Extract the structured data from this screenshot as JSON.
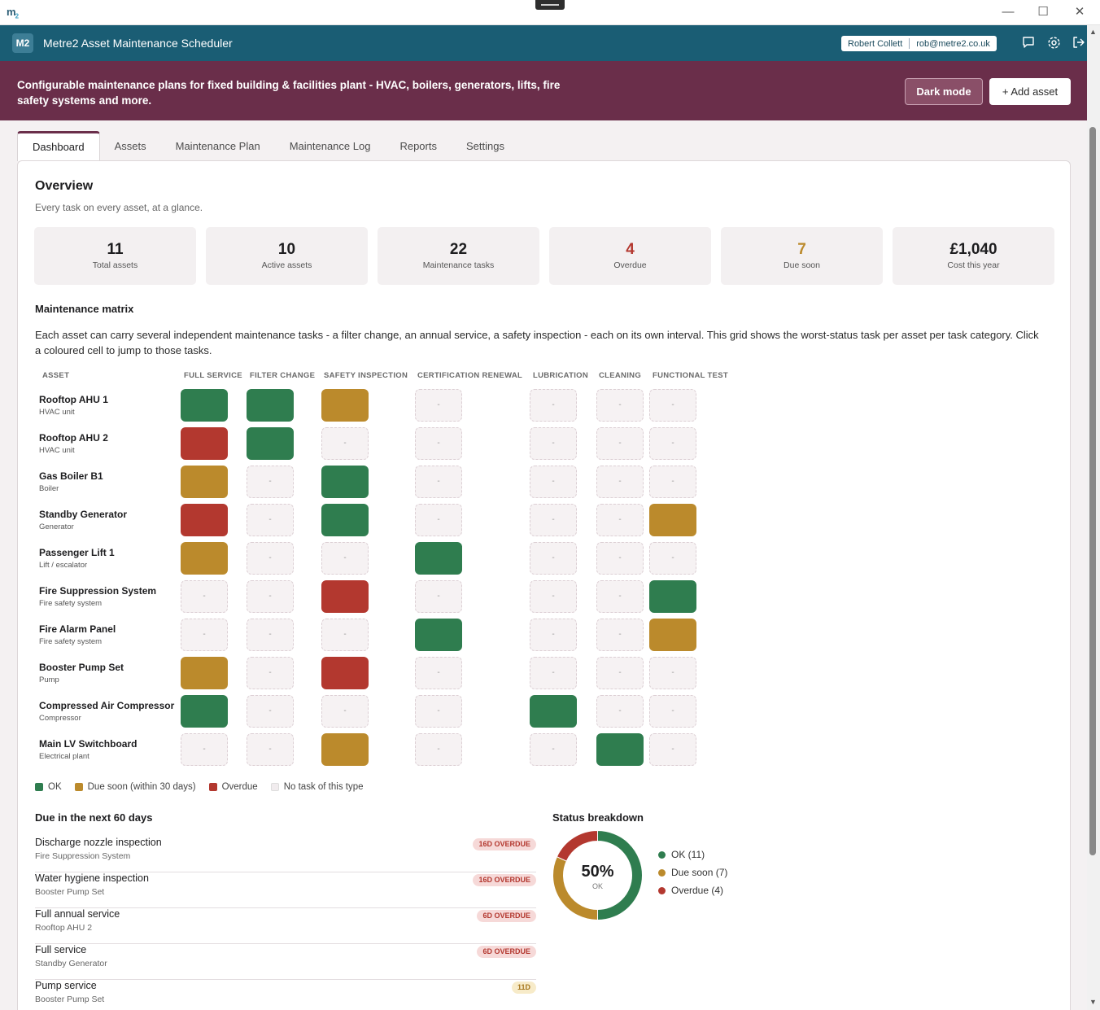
{
  "window": {
    "logo": "m",
    "logo_sub": "2",
    "minimize": "—",
    "maximize": "☐",
    "close": "✕"
  },
  "appbar": {
    "logo": "M2",
    "title": "Metre2 Asset Maintenance Scheduler",
    "user_name": "Robert Collett",
    "user_email": "rob@metre2.co.uk"
  },
  "banner": {
    "text": "Configurable maintenance plans for fixed building & facilities plant - HVAC, boilers, generators, lifts, fire safety systems and more.",
    "dark_mode_label": "Dark mode",
    "add_asset_label": "+ Add asset"
  },
  "tabs": [
    "Dashboard",
    "Assets",
    "Maintenance Plan",
    "Maintenance Log",
    "Reports",
    "Settings"
  ],
  "overview": {
    "title": "Overview",
    "subtitle": "Every task on every asset, at a glance."
  },
  "stats": [
    {
      "value": "11",
      "label": "Total assets",
      "color": "#1d1d1f"
    },
    {
      "value": "10",
      "label": "Active assets",
      "color": "#1d1d1f"
    },
    {
      "value": "22",
      "label": "Maintenance tasks",
      "color": "#1d1d1f"
    },
    {
      "value": "4",
      "label": "Overdue",
      "color": "#b3382f"
    },
    {
      "value": "7",
      "label": "Due soon",
      "color": "#bb8a2c"
    },
    {
      "value": "£1,040",
      "label": "Cost this year",
      "color": "#1d1d1f"
    }
  ],
  "matrix": {
    "title": "Maintenance matrix",
    "description": "Each asset can carry several independent maintenance tasks - a filter change, an annual service, a safety inspection - each on its own interval. This grid shows the worst-status task per asset per task category. Click a coloured cell to jump to those tasks.",
    "asset_header": "ASSET",
    "columns": [
      "FULL SERVICE",
      "FILTER CHANGE",
      "SAFETY INSPECTION",
      "CERTIFICATION RENEWAL",
      "LUBRICATION",
      "CLEANING",
      "FUNCTIONAL TEST"
    ],
    "empty_symbol": "-",
    "rows": [
      {
        "name": "Rooftop AHU 1",
        "type": "HVAC unit",
        "cells": [
          "ok",
          "ok",
          "due",
          "none",
          "none",
          "none",
          "none"
        ]
      },
      {
        "name": "Rooftop AHU 2",
        "type": "HVAC unit",
        "cells": [
          "over",
          "ok",
          "none",
          "none",
          "none",
          "none",
          "none"
        ]
      },
      {
        "name": "Gas Boiler B1",
        "type": "Boiler",
        "cells": [
          "due",
          "none",
          "ok",
          "none",
          "none",
          "none",
          "none"
        ]
      },
      {
        "name": "Standby Generator",
        "type": "Generator",
        "cells": [
          "over",
          "none",
          "ok",
          "none",
          "none",
          "none",
          "due"
        ]
      },
      {
        "name": "Passenger Lift 1",
        "type": "Lift / escalator",
        "cells": [
          "due",
          "none",
          "none",
          "ok",
          "none",
          "none",
          "none"
        ]
      },
      {
        "name": "Fire Suppression System",
        "type": "Fire safety system",
        "cells": [
          "none",
          "none",
          "over",
          "none",
          "none",
          "none",
          "ok"
        ]
      },
      {
        "name": "Fire Alarm Panel",
        "type": "Fire safety system",
        "cells": [
          "none",
          "none",
          "none",
          "ok",
          "none",
          "none",
          "due"
        ]
      },
      {
        "name": "Booster Pump Set",
        "type": "Pump",
        "cells": [
          "due",
          "none",
          "over",
          "none",
          "none",
          "none",
          "none"
        ]
      },
      {
        "name": "Compressed Air Compressor",
        "type": "Compressor",
        "cells": [
          "ok",
          "none",
          "none",
          "none",
          "ok",
          "none",
          "none"
        ]
      },
      {
        "name": "Main LV Switchboard",
        "type": "Electrical plant",
        "cells": [
          "none",
          "none",
          "due",
          "none",
          "none",
          "ok",
          "none"
        ]
      }
    ],
    "legend": [
      {
        "label": "OK",
        "color": "#2f7d4f"
      },
      {
        "label": "Due soon (within 30 days)",
        "color": "#bb8a2c"
      },
      {
        "label": "Overdue",
        "color": "#b3382f"
      },
      {
        "label": "No task of this type",
        "color": "#f1ecee"
      }
    ]
  },
  "due": {
    "title": "Due in the next 60 days",
    "items": [
      {
        "task": "Discharge nozzle inspection",
        "asset": "Fire Suppression System",
        "badge": "16D OVERDUE",
        "status": "over"
      },
      {
        "task": "Water hygiene inspection",
        "asset": "Booster Pump Set",
        "badge": "16D OVERDUE",
        "status": "over"
      },
      {
        "task": "Full annual service",
        "asset": "Rooftop AHU 2",
        "badge": "6D OVERDUE",
        "status": "over"
      },
      {
        "task": "Full service",
        "asset": "Standby Generator",
        "badge": "6D OVERDUE",
        "status": "over"
      },
      {
        "task": "Pump service",
        "asset": "Booster Pump Set",
        "badge": "11D",
        "status": "due"
      }
    ]
  },
  "status_breakdown": {
    "title": "Status breakdown",
    "percent": "50%",
    "percent_label": "OK",
    "segments": [
      {
        "label": "OK (11)",
        "count": 11,
        "color": "#2f7d4f"
      },
      {
        "label": "Due soon (7)",
        "count": 7,
        "color": "#bb8a2c"
      },
      {
        "label": "Overdue (4)",
        "count": 4,
        "color": "#b3382f"
      }
    ]
  }
}
